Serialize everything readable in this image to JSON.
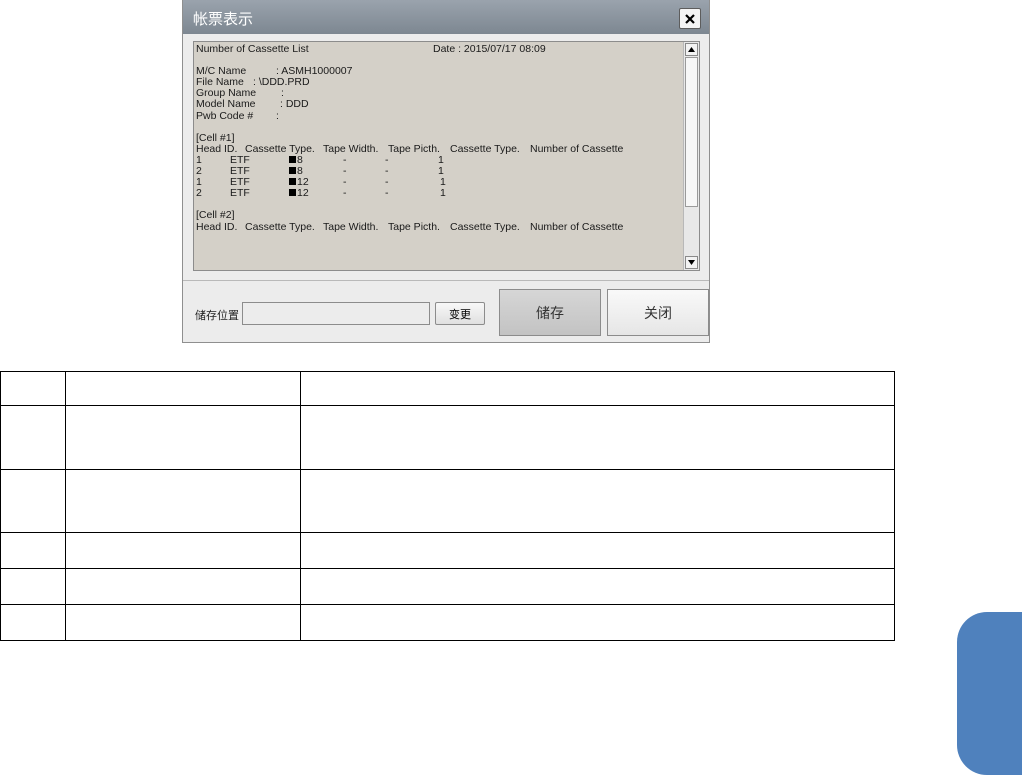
{
  "dialog": {
    "title": "帐票表示",
    "close_symbol": "✕",
    "report": {
      "heading": "Number of Cassette List",
      "date": "Date : 2015/07/17 08:09",
      "mc_name_label": "M/C Name",
      "mc_name_value": ": ASMH1000007",
      "file_name_label": "File Name",
      "file_name_value": ": \\DDD.PRD",
      "group_name_label": "Group Name",
      "group_name_value": ":",
      "model_name_label": "Model Name",
      "model_name_value": ": DDD",
      "pwb_code_label": "Pwb Code #",
      "pwb_code_value": ":",
      "cell1_label": "[Cell #1]",
      "columns": [
        "Head ID.",
        "Cassette Type.",
        "Tape Width.",
        "Tape Picth.",
        "Cassette Type.",
        "Number of Cassette"
      ],
      "rows": [
        {
          "head": "1",
          "type": "ETF",
          "width": "8",
          "pitch": "-",
          "ctype": "-",
          "count": "1"
        },
        {
          "head": "2",
          "type": "ETF",
          "width": "8",
          "pitch": "-",
          "ctype": "-",
          "count": "1"
        },
        {
          "head": "1",
          "type": "ETF",
          "width": "12",
          "pitch": "-",
          "ctype": "-",
          "count": "1"
        },
        {
          "head": "2",
          "type": "ETF",
          "width": "12",
          "pitch": "-",
          "ctype": "-",
          "count": "1"
        }
      ],
      "cell2_label": "[Cell #2]"
    },
    "save_location_label": "储存位置",
    "save_location_value": "",
    "change_button": "变更",
    "save_button": "储存",
    "close_button": "关闭"
  },
  "table": {
    "rows": [
      [
        "",
        "",
        ""
      ],
      [
        "",
        "",
        ""
      ],
      [
        "",
        "",
        ""
      ],
      [
        "",
        "",
        ""
      ],
      [
        "",
        "",
        ""
      ],
      [
        "",
        "",
        ""
      ]
    ]
  },
  "colors": {
    "title_bar": "#8a939c",
    "report_background": "#d4d0c8",
    "side_tab": "#4f81bd"
  }
}
